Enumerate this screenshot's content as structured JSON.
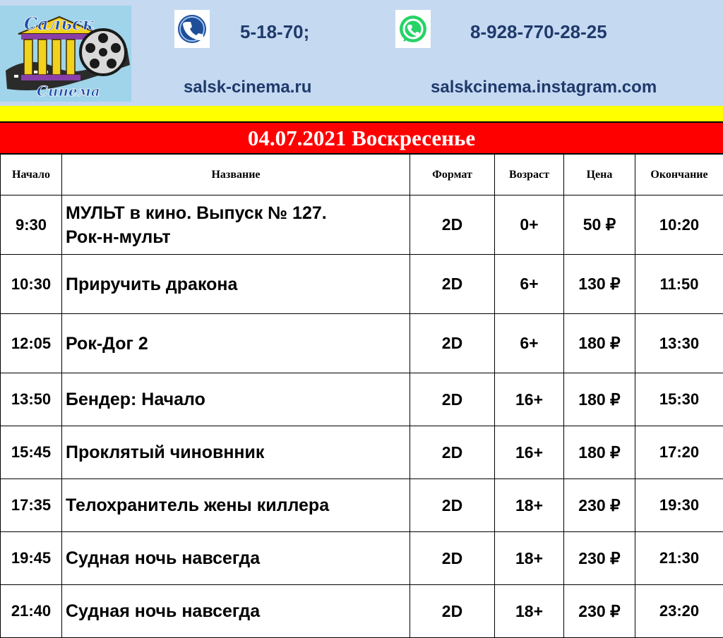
{
  "header": {
    "logo_text_top": "Сальск",
    "logo_text_bottom": "Синема",
    "phone": "5-18-70;",
    "whatsapp": "8-928-770-28-25",
    "website": "salsk-cinema.ru",
    "instagram": "salskcinema.instagram.com",
    "colors": {
      "header_bg": "#c5d9f1",
      "text": "#1f3a6b",
      "phone_icon": "#1f4e99",
      "whatsapp_icon": "#25d366"
    }
  },
  "banner": {
    "date_title": "04.07.2021 Воскресенье",
    "colors": {
      "stripe": "#ffff00",
      "bg": "#ff0000",
      "text": "#ffffff"
    }
  },
  "table": {
    "headers": [
      "Начало",
      "Название",
      "Формат",
      "Возраст",
      "Цена",
      "Окончание"
    ],
    "rows": [
      {
        "start": "9:30",
        "title_line1": "МУЛЬТ в кино. Выпуск № 127.",
        "title_line2": "Рок-н-мульт",
        "format": "2D",
        "age": "0+",
        "price": "50 ₽",
        "end": "10:20"
      },
      {
        "start": "10:30",
        "title_line1": "Приручить дракона",
        "title_line2": "",
        "format": "2D",
        "age": "6+",
        "price": "130 ₽",
        "end": "11:50"
      },
      {
        "start": "12:05",
        "title_line1": "Рок-Дог 2",
        "title_line2": "",
        "format": "2D",
        "age": "6+",
        "price": "180 ₽",
        "end": "13:30"
      },
      {
        "start": "13:50",
        "title_line1": "Бендер: Начало",
        "title_line2": "",
        "format": "2D",
        "age": "16+",
        "price": "180 ₽",
        "end": "15:30"
      },
      {
        "start": "15:45",
        "title_line1": "Проклятый чиновнник",
        "title_line2": "",
        "format": "2D",
        "age": "16+",
        "price": "180 ₽",
        "end": "17:20"
      },
      {
        "start": "17:35",
        "title_line1": "Телохранитель жены киллера",
        "title_line2": "",
        "format": "2D",
        "age": "18+",
        "price": "230 ₽",
        "end": "19:30"
      },
      {
        "start": "19:45",
        "title_line1": "Судная ночь навсегда",
        "title_line2": "",
        "format": "2D",
        "age": "18+",
        "price": "230 ₽",
        "end": "21:30"
      },
      {
        "start": "21:40",
        "title_line1": "Судная ночь навсегда",
        "title_line2": "",
        "format": "2D",
        "age": "18+",
        "price": "230 ₽",
        "end": "23:20"
      }
    ]
  }
}
